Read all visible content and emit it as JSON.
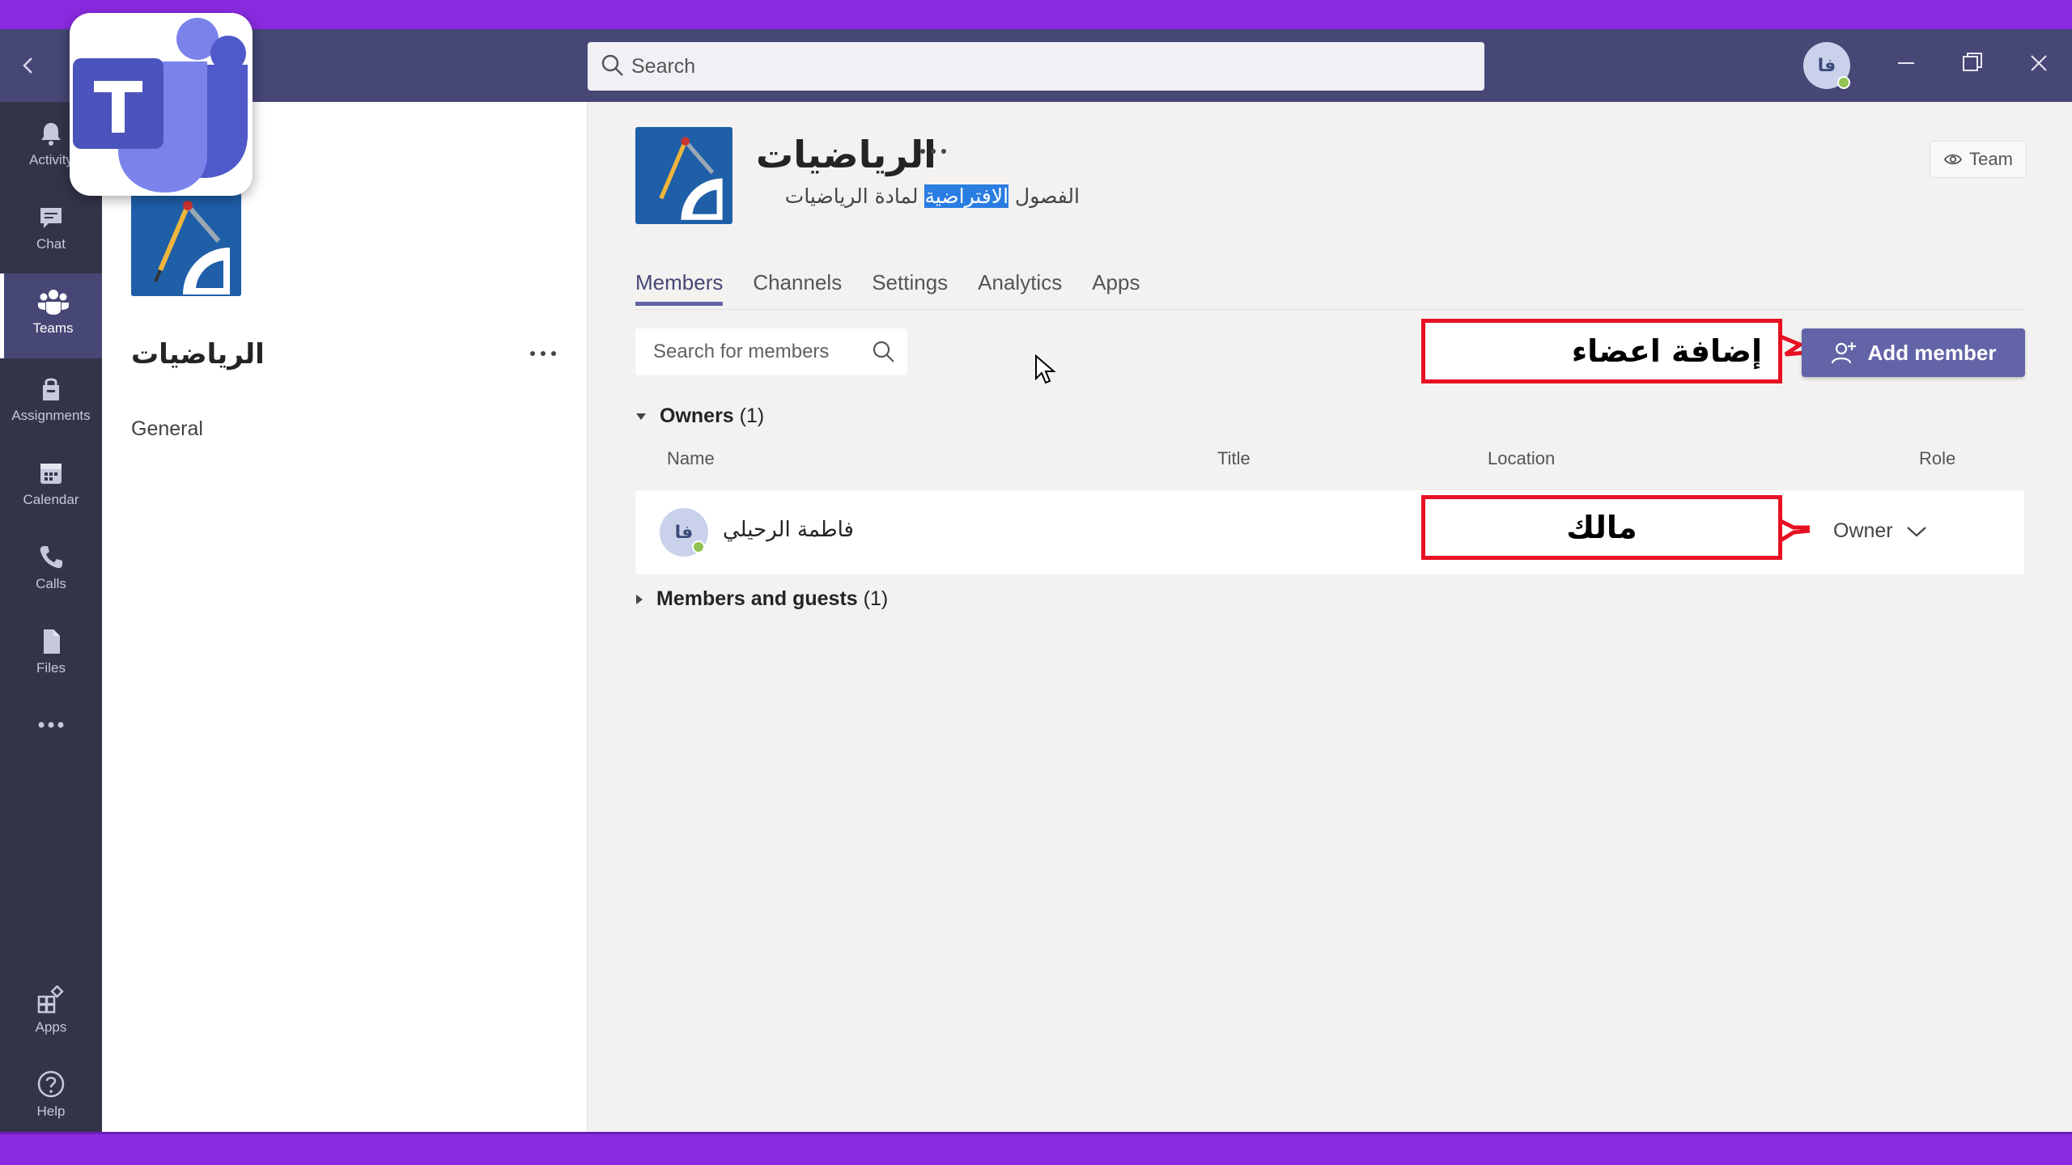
{
  "titlebar": {
    "search_placeholder": "Search",
    "avatar_initials": "فا"
  },
  "rail": {
    "items": [
      {
        "label": "Activity",
        "icon": "bell-icon"
      },
      {
        "label": "Chat",
        "icon": "chat-icon"
      },
      {
        "label": "Teams",
        "icon": "teams-icon"
      },
      {
        "label": "Assignments",
        "icon": "assignments-icon"
      },
      {
        "label": "Calendar",
        "icon": "calendar-icon"
      },
      {
        "label": "Calls",
        "icon": "phone-icon"
      },
      {
        "label": "Files",
        "icon": "file-icon"
      },
      {
        "label": "Apps",
        "icon": "apps-icon"
      },
      {
        "label": "Help",
        "icon": "help-icon"
      }
    ]
  },
  "sidebar": {
    "team_name": "الرياضيات",
    "channel": "General"
  },
  "header": {
    "team_name": "الرياضيات",
    "description_before": "الفصول ",
    "description_highlight": "الافتراضية",
    "description_after": " لمادة الرياضيات",
    "team_button": "Team"
  },
  "tabs": [
    "Members",
    "Channels",
    "Settings",
    "Analytics",
    "Apps"
  ],
  "members": {
    "search_placeholder": "Search for members",
    "add_member_label": "Add member",
    "owners_label": "Owners",
    "owners_count": "(1)",
    "members_label": "Members and guests",
    "members_count": "(1)",
    "columns": {
      "name": "Name",
      "title": "Title",
      "location": "Location",
      "role": "Role"
    },
    "owner": {
      "initials": "فا",
      "name": "فاطمة الرحيلي",
      "role": "Owner"
    }
  },
  "annotations": {
    "add_members": "إضافة اعضاء",
    "owner": "مالك"
  },
  "colors": {
    "frame": "#8a2be2",
    "titlebar": "#464775",
    "rail": "#33344a",
    "accent": "#6264a7",
    "annotation": "#e81123"
  }
}
